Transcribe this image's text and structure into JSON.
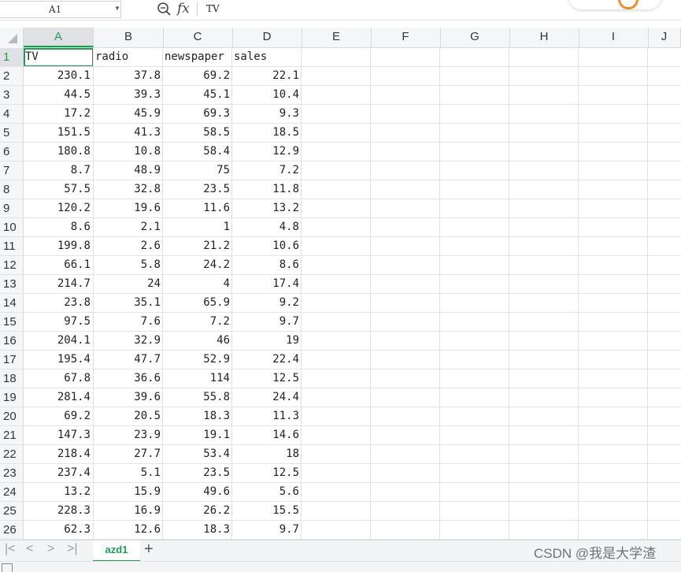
{
  "formula_bar": {
    "name_box": "A1",
    "fx_label": "fx",
    "value": "TV"
  },
  "columns": [
    "A",
    "B",
    "C",
    "D",
    "E",
    "F",
    "G",
    "H",
    "I",
    "J"
  ],
  "active_column": "A",
  "active_row": "1",
  "rows": [
    {
      "n": "1",
      "cells": [
        "TV",
        "radio",
        "newspaper",
        "sales"
      ],
      "header": true
    },
    {
      "n": "2",
      "cells": [
        "230.1",
        "37.8",
        "69.2",
        "22.1"
      ]
    },
    {
      "n": "3",
      "cells": [
        "44.5",
        "39.3",
        "45.1",
        "10.4"
      ]
    },
    {
      "n": "4",
      "cells": [
        "17.2",
        "45.9",
        "69.3",
        "9.3"
      ]
    },
    {
      "n": "5",
      "cells": [
        "151.5",
        "41.3",
        "58.5",
        "18.5"
      ]
    },
    {
      "n": "6",
      "cells": [
        "180.8",
        "10.8",
        "58.4",
        "12.9"
      ]
    },
    {
      "n": "7",
      "cells": [
        "8.7",
        "48.9",
        "75",
        "7.2"
      ]
    },
    {
      "n": "8",
      "cells": [
        "57.5",
        "32.8",
        "23.5",
        "11.8"
      ]
    },
    {
      "n": "9",
      "cells": [
        "120.2",
        "19.6",
        "11.6",
        "13.2"
      ]
    },
    {
      "n": "10",
      "cells": [
        "8.6",
        "2.1",
        "1",
        "4.8"
      ]
    },
    {
      "n": "11",
      "cells": [
        "199.8",
        "2.6",
        "21.2",
        "10.6"
      ]
    },
    {
      "n": "12",
      "cells": [
        "66.1",
        "5.8",
        "24.2",
        "8.6"
      ]
    },
    {
      "n": "13",
      "cells": [
        "214.7",
        "24",
        "4",
        "17.4"
      ]
    },
    {
      "n": "14",
      "cells": [
        "23.8",
        "35.1",
        "65.9",
        "9.2"
      ]
    },
    {
      "n": "15",
      "cells": [
        "97.5",
        "7.6",
        "7.2",
        "9.7"
      ]
    },
    {
      "n": "16",
      "cells": [
        "204.1",
        "32.9",
        "46",
        "19"
      ]
    },
    {
      "n": "17",
      "cells": [
        "195.4",
        "47.7",
        "52.9",
        "22.4"
      ]
    },
    {
      "n": "18",
      "cells": [
        "67.8",
        "36.6",
        "114",
        "12.5"
      ]
    },
    {
      "n": "19",
      "cells": [
        "281.4",
        "39.6",
        "55.8",
        "24.4"
      ]
    },
    {
      "n": "20",
      "cells": [
        "69.2",
        "20.5",
        "18.3",
        "11.3"
      ]
    },
    {
      "n": "21",
      "cells": [
        "147.3",
        "23.9",
        "19.1",
        "14.6"
      ]
    },
    {
      "n": "22",
      "cells": [
        "218.4",
        "27.7",
        "53.4",
        "18"
      ]
    },
    {
      "n": "23",
      "cells": [
        "237.4",
        "5.1",
        "23.5",
        "12.5"
      ]
    },
    {
      "n": "24",
      "cells": [
        "13.2",
        "15.9",
        "49.6",
        "5.6"
      ]
    },
    {
      "n": "25",
      "cells": [
        "228.3",
        "16.9",
        "26.2",
        "15.5"
      ]
    },
    {
      "n": "26",
      "cells": [
        "62.3",
        "12.6",
        "18.3",
        "9.7"
      ]
    }
  ],
  "sheet_tabs": [
    "azd1"
  ],
  "add_sheet_label": "+",
  "sheet_nav": [
    "|<",
    "<",
    ">",
    ">|"
  ],
  "watermark": "CSDN @我是大学渣",
  "colors": {
    "accent": "#1f9d55",
    "grid": "#dfe1e5",
    "header_bg": "#f5f6f7"
  }
}
